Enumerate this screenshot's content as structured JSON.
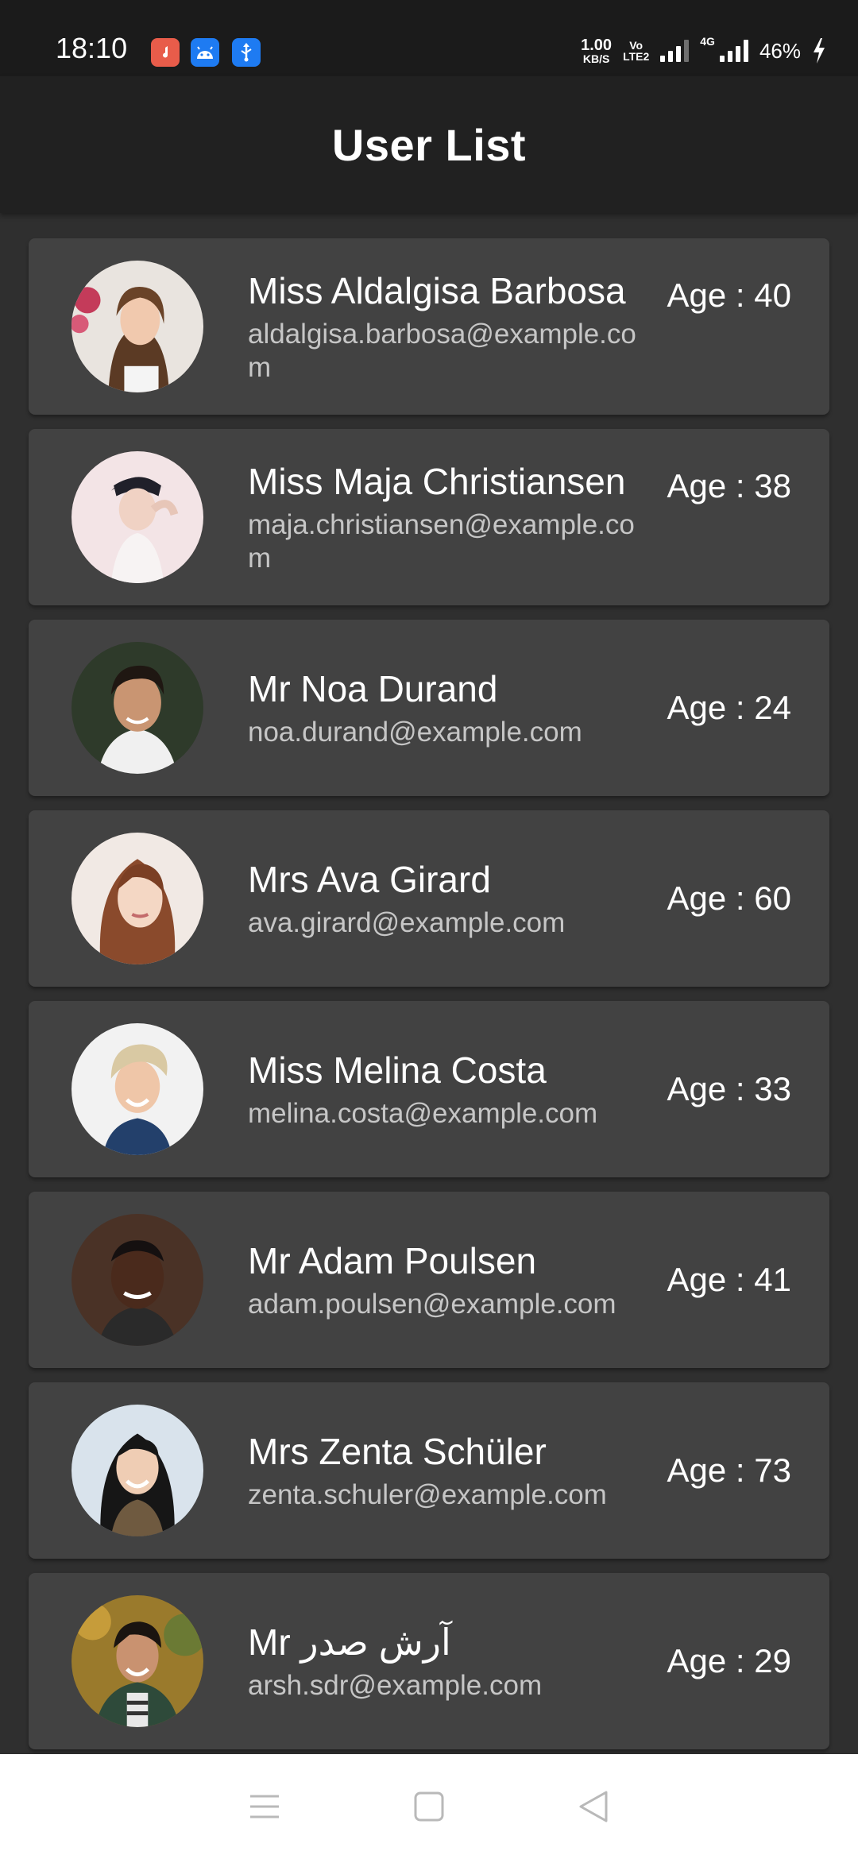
{
  "status": {
    "time": "18:10",
    "netspeed_value": "1.00",
    "netspeed_unit": "KB/S",
    "volte_top": "Vo",
    "volte_bottom": "LTE2",
    "network_type": "4G",
    "battery": "46%",
    "notification_icons": [
      "music-icon",
      "android-icon",
      "usb-icon"
    ]
  },
  "app_bar": {
    "title": "User List"
  },
  "users": [
    {
      "name": "Miss Aldalgisa Barbosa",
      "email": "aldalgisa.barbosa@example.com",
      "age": "Age : 40"
    },
    {
      "name": "Miss Maja Christiansen",
      "email": "maja.christiansen@example.com",
      "age": "Age : 38"
    },
    {
      "name": "Mr Noa Durand",
      "email": "noa.durand@example.com",
      "age": "Age : 24"
    },
    {
      "name": "Mrs Ava Girard",
      "email": "ava.girard@example.com",
      "age": "Age : 60"
    },
    {
      "name": "Miss Melina Costa",
      "email": "melina.costa@example.com",
      "age": "Age : 33"
    },
    {
      "name": "Mr Adam Poulsen",
      "email": "adam.poulsen@example.com",
      "age": "Age : 41"
    },
    {
      "name": "Mrs Zenta Schüler",
      "email": "zenta.schuler@example.com",
      "age": "Age : 73"
    },
    {
      "name": "Mr آرش صدر",
      "email": "arsh.sdr@example.com",
      "age": "Age : 29"
    }
  ],
  "nav": {
    "icons": [
      "menu-icon",
      "home-square-icon",
      "back-triangle-icon"
    ]
  },
  "colors": {
    "background": "#2f2f2f",
    "card": "#424242",
    "app_bar": "#212121",
    "status_bar": "#1b1b1b",
    "music_app": "#e85c4a",
    "android_app": "#1e7bf2",
    "usb_app": "#1e7bf2"
  }
}
